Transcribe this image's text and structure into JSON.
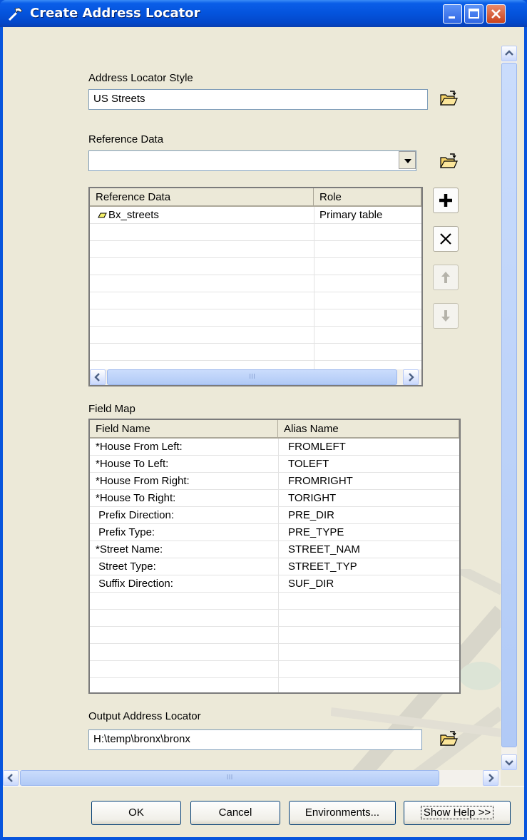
{
  "window": {
    "title": "Create Address Locator"
  },
  "address_locator_style": {
    "label": "Address Locator Style",
    "value": "US Streets"
  },
  "reference_data": {
    "label": "Reference Data",
    "combo_value": "",
    "table": {
      "columns": [
        "Reference Data",
        "Role"
      ],
      "rows": [
        {
          "name": "Bx_streets",
          "role": "Primary table"
        }
      ]
    },
    "scroll_thumb_grip": "III"
  },
  "field_map": {
    "label": "Field Map",
    "columns": [
      "Field Name",
      "Alias Name"
    ],
    "rows": [
      {
        "field": "*House From Left:",
        "alias": "FROMLEFT"
      },
      {
        "field": "*House To Left:",
        "alias": "TOLEFT"
      },
      {
        "field": "*House From Right:",
        "alias": "FROMRIGHT"
      },
      {
        "field": "*House To Right:",
        "alias": "TORIGHT"
      },
      {
        "field": " Prefix Direction:",
        "alias": "PRE_DIR"
      },
      {
        "field": " Prefix Type:",
        "alias": "PRE_TYPE"
      },
      {
        "field": "*Street Name:",
        "alias": "STREET_NAM"
      },
      {
        "field": " Street Type:",
        "alias": "STREET_TYP"
      },
      {
        "field": " Suffix Direction:",
        "alias": "SUF_DIR"
      }
    ]
  },
  "output_address_locator": {
    "label": "Output Address Locator",
    "value": "H:\\temp\\bronx\\bronx"
  },
  "main_hscroll_grip": "III",
  "buttons": {
    "ok": "OK",
    "cancel": "Cancel",
    "environments": "Environments...",
    "show_help": "Show Help >>"
  }
}
